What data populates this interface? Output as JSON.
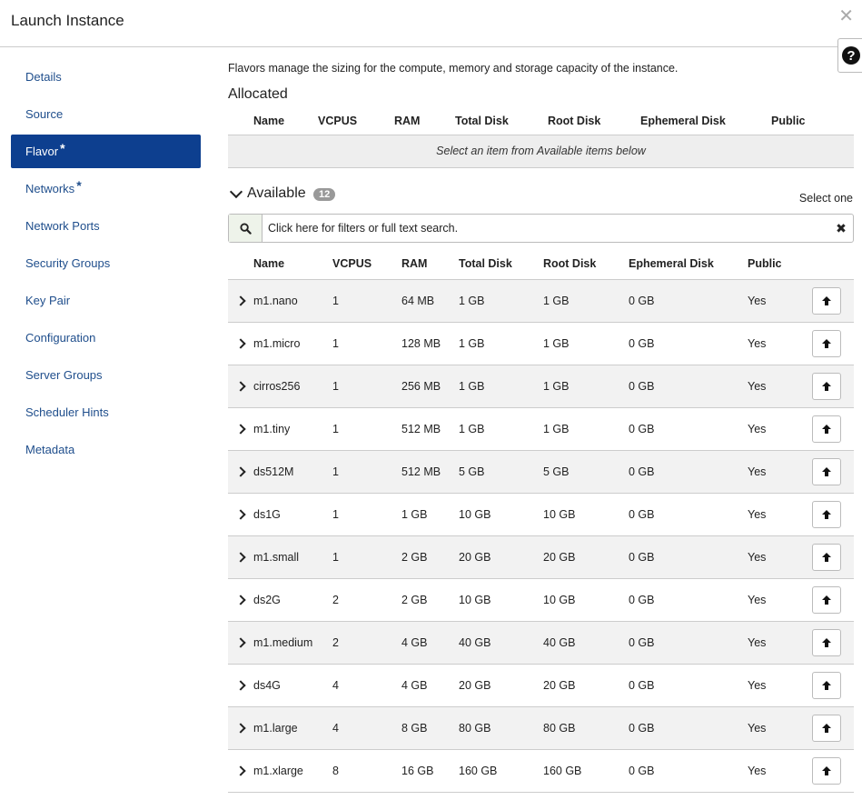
{
  "header": {
    "title": "Launch Instance",
    "close": "✕",
    "help": "?"
  },
  "nav": [
    {
      "label": "Details",
      "required": false,
      "active": false
    },
    {
      "label": "Source",
      "required": false,
      "active": false
    },
    {
      "label": "Flavor",
      "required": true,
      "active": true
    },
    {
      "label": "Networks",
      "required": true,
      "active": false
    },
    {
      "label": "Network Ports",
      "required": false,
      "active": false
    },
    {
      "label": "Security Groups",
      "required": false,
      "active": false
    },
    {
      "label": "Key Pair",
      "required": false,
      "active": false
    },
    {
      "label": "Configuration",
      "required": false,
      "active": false
    },
    {
      "label": "Server Groups",
      "required": false,
      "active": false
    },
    {
      "label": "Scheduler Hints",
      "required": false,
      "active": false
    },
    {
      "label": "Metadata",
      "required": false,
      "active": false
    }
  ],
  "main": {
    "intro": "Flavors manage the sizing for the compute, memory and storage capacity of the instance.",
    "allocated": {
      "title": "Allocated",
      "columns": [
        "Name",
        "VCPUS",
        "RAM",
        "Total Disk",
        "Root Disk",
        "Ephemeral Disk",
        "Public"
      ],
      "empty_text": "Select an item from Available items below"
    },
    "available": {
      "title": "Available",
      "count": "12",
      "select_hint": "Select one",
      "search_placeholder": "Click here for filters or full text search.",
      "columns": [
        "Name",
        "VCPUS",
        "RAM",
        "Total Disk",
        "Root Disk",
        "Ephemeral Disk",
        "Public"
      ],
      "rows": [
        [
          "m1.nano",
          "1",
          "64 MB",
          "1 GB",
          "1 GB",
          "0 GB",
          "Yes"
        ],
        [
          "m1.micro",
          "1",
          "128 MB",
          "1 GB",
          "1 GB",
          "0 GB",
          "Yes"
        ],
        [
          "cirros256",
          "1",
          "256 MB",
          "1 GB",
          "1 GB",
          "0 GB",
          "Yes"
        ],
        [
          "m1.tiny",
          "1",
          "512 MB",
          "1 GB",
          "1 GB",
          "0 GB",
          "Yes"
        ],
        [
          "ds512M",
          "1",
          "512 MB",
          "5 GB",
          "5 GB",
          "0 GB",
          "Yes"
        ],
        [
          "ds1G",
          "1",
          "1 GB",
          "10 GB",
          "10 GB",
          "0 GB",
          "Yes"
        ],
        [
          "m1.small",
          "1",
          "2 GB",
          "20 GB",
          "20 GB",
          "0 GB",
          "Yes"
        ],
        [
          "ds2G",
          "2",
          "2 GB",
          "10 GB",
          "10 GB",
          "0 GB",
          "Yes"
        ],
        [
          "m1.medium",
          "2",
          "4 GB",
          "40 GB",
          "40 GB",
          "0 GB",
          "Yes"
        ],
        [
          "ds4G",
          "4",
          "4 GB",
          "20 GB",
          "20 GB",
          "0 GB",
          "Yes"
        ],
        [
          "m1.large",
          "4",
          "8 GB",
          "80 GB",
          "80 GB",
          "0 GB",
          "Yes"
        ],
        [
          "m1.xlarge",
          "8",
          "16 GB",
          "160 GB",
          "160 GB",
          "0 GB",
          "Yes"
        ]
      ]
    }
  }
}
